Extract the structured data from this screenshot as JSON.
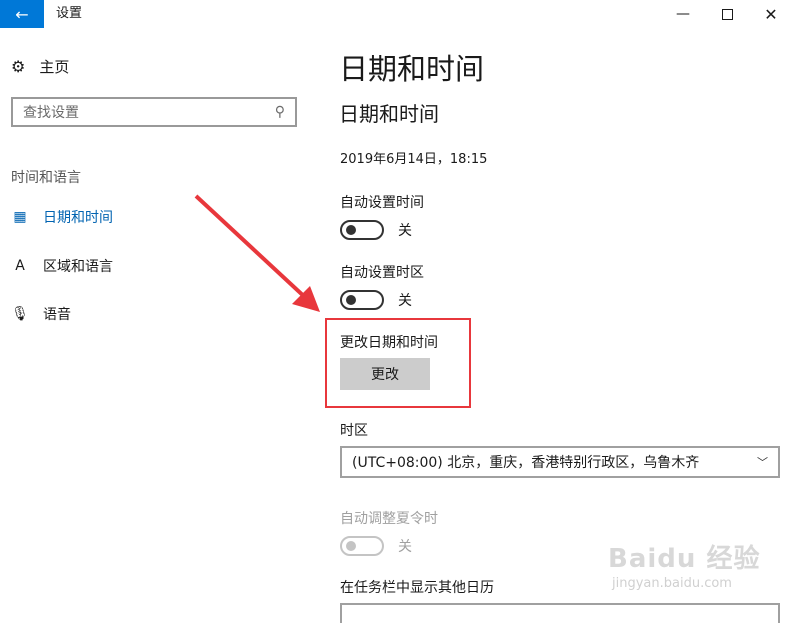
{
  "window": {
    "title": "设置",
    "back_icon": "←",
    "minimize": "—",
    "close": "✕"
  },
  "sidebar": {
    "home_label": "主页",
    "search_placeholder": "查找设置",
    "section": "时间和语言",
    "items": [
      {
        "label": "日期和时间",
        "icon": "calendar-clock-icon",
        "active": true
      },
      {
        "label": "区域和语言",
        "icon": "language-icon",
        "active": false
      },
      {
        "label": "语音",
        "icon": "microphone-icon",
        "active": false
      }
    ]
  },
  "main": {
    "page_title": "日期和时间",
    "section_title": "日期和时间",
    "current_datetime": "2019年6月14日，18:15",
    "auto_time": {
      "label": "自动设置时间",
      "state": "关"
    },
    "auto_timezone": {
      "label": "自动设置时区",
      "state": "关"
    },
    "change": {
      "label": "更改日期和时间",
      "button": "更改"
    },
    "timezone": {
      "label": "时区",
      "value": "(UTC+08:00) 北京，重庆，香港特别行政区，乌鲁木齐"
    },
    "dst": {
      "label": "自动调整夏令时",
      "state": "关"
    },
    "calendar": {
      "label": "在任务栏中显示其他日历"
    }
  },
  "watermark": {
    "main": "Baidu 经验",
    "sub": "jingyan.baidu.com"
  },
  "colors": {
    "accent": "#0078d7",
    "active_nav": "#0063b1",
    "annotation": "#e8373c"
  }
}
